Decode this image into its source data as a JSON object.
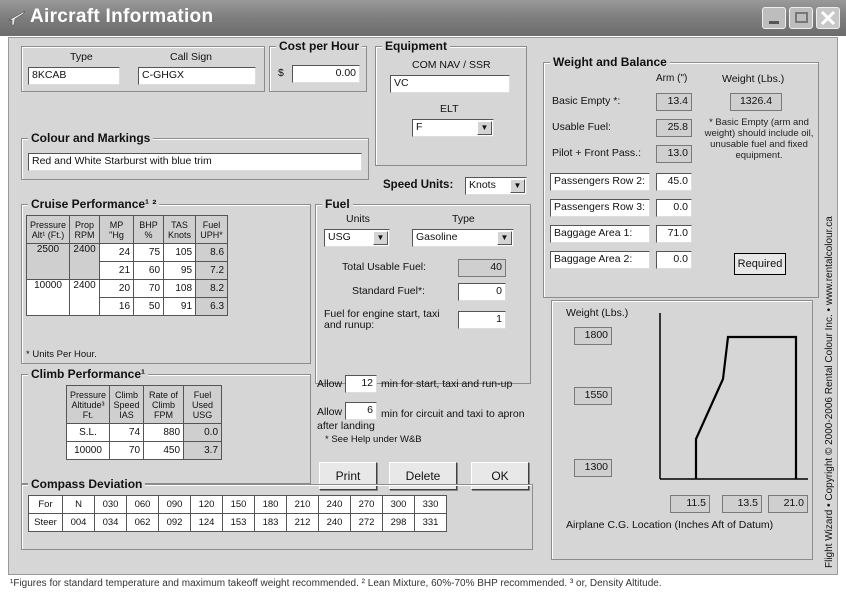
{
  "window": {
    "title": "Aircraft Information"
  },
  "type_box": {
    "type_label": "Type",
    "type_value": "8KCAB",
    "callsign_label": "Call Sign",
    "callsign_value": "C-GHGX"
  },
  "cost": {
    "title": "Cost per Hour",
    "currency": "$",
    "value": "0.00"
  },
  "equipment": {
    "title": "Equipment",
    "com_label": "COM NAV / SSR",
    "com_value": "VC",
    "elt_label": "ELT",
    "elt_value": "F"
  },
  "colour": {
    "title": "Colour and Markings",
    "value": "Red and White Starburst with blue trim"
  },
  "speed_units": {
    "label": "Speed Units:",
    "value": "Knots"
  },
  "cruise": {
    "title": "Cruise Performance¹ ²",
    "headers": [
      "Pressure Alt¹ (Ft.)",
      "Prop RPM",
      "MP \"Hg",
      "BHP %",
      "TAS Knots",
      "Fuel UPH*"
    ],
    "rows": [
      [
        "2500",
        "2400",
        "24",
        "75",
        "105",
        "8.6"
      ],
      [
        "",
        "",
        "21",
        "60",
        "95",
        "7.2"
      ],
      [
        "10000",
        "2400",
        "20",
        "70",
        "108",
        "8.2"
      ],
      [
        "",
        "",
        "16",
        "50",
        "91",
        "6.3"
      ]
    ],
    "note": "* Units Per Hour."
  },
  "fuel": {
    "title": "Fuel",
    "units_label": "Units",
    "type_label": "Type",
    "units_value": "USG",
    "type_value": "Gasoline",
    "total_label": "Total Usable Fuel:",
    "total_value": "40",
    "standard_label": "Standard Fuel*:",
    "standard_value": "0",
    "engine_label": "Fuel for engine start, taxi and runup:",
    "engine_value": "1",
    "allow1_prefix": "Allow",
    "allow1_value": "12",
    "allow1_suffix": "min for start, taxi and run-up",
    "allow2_prefix": "Allow",
    "allow2_value": "6",
    "allow2_suffix": "min for circuit and taxi to apron after landing",
    "help_note": "* See Help under W&B"
  },
  "climb": {
    "title": "Climb Performance¹",
    "headers": [
      "Pressure Altitude³ Ft.",
      "Climb Speed IAS",
      "Rate of Climb FPM",
      "Fuel Used USG"
    ],
    "rows": [
      [
        "S.L.",
        "74",
        "880",
        "0.0"
      ],
      [
        "10000",
        "70",
        "450",
        "3.7"
      ]
    ]
  },
  "buttons": {
    "print": "Print",
    "delete": "Delete",
    "ok": "OK"
  },
  "wb": {
    "title": "Weight and Balance",
    "arm_header": "Arm (\")",
    "weight_header": "Weight (Lbs.)",
    "basic_label": "Basic Empty *:",
    "basic_arm": "13.4",
    "basic_weight": "1326.4",
    "usable_label": "Usable Fuel:",
    "usable_arm": "25.8",
    "pilot_label": "Pilot + Front Pass.:",
    "pilot_arm": "13.0",
    "row2_label": "Passengers Row 2:",
    "row2_arm": "45.0",
    "row3_label": "Passengers Row 3:",
    "row3_arm": "0.0",
    "bag1_label": "Baggage Area 1:",
    "bag1_arm": "71.0",
    "bag2_label": "Baggage Area 2:",
    "bag2_arm": "0.0",
    "note": "* Basic Empty (arm and weight) should include oil, unusable fuel and fixed equipment.",
    "required_button": "Required"
  },
  "cg_chart": {
    "weight_label": "Weight (Lbs.)",
    "w_top": "1800",
    "w_mid": "1550",
    "w_bot": "1300",
    "x1": "11.5",
    "x2": "13.5",
    "x3": "21.0",
    "caption": "Airplane C.G. Location (Inches Aft of Datum)"
  },
  "compass": {
    "title": "Compass Deviation",
    "for_label": "For",
    "steer_label": "Steer",
    "for": [
      "N",
      "030",
      "060",
      "090",
      "120",
      "150",
      "180",
      "210",
      "240",
      "270",
      "300",
      "330"
    ],
    "steer": [
      "004",
      "034",
      "062",
      "092",
      "124",
      "153",
      "183",
      "212",
      "240",
      "272",
      "298",
      "331"
    ]
  },
  "footnote": "¹Figures for standard temperature and maximum takeoff weight recommended. ² Lean Mixture, 60%-70% BHP recommended. ³ or, Density Altitude.",
  "side_text": "Flight Wizard • Copyright © 2000-2006 Rental Colour Inc. • www.rentalcolour.ca"
}
